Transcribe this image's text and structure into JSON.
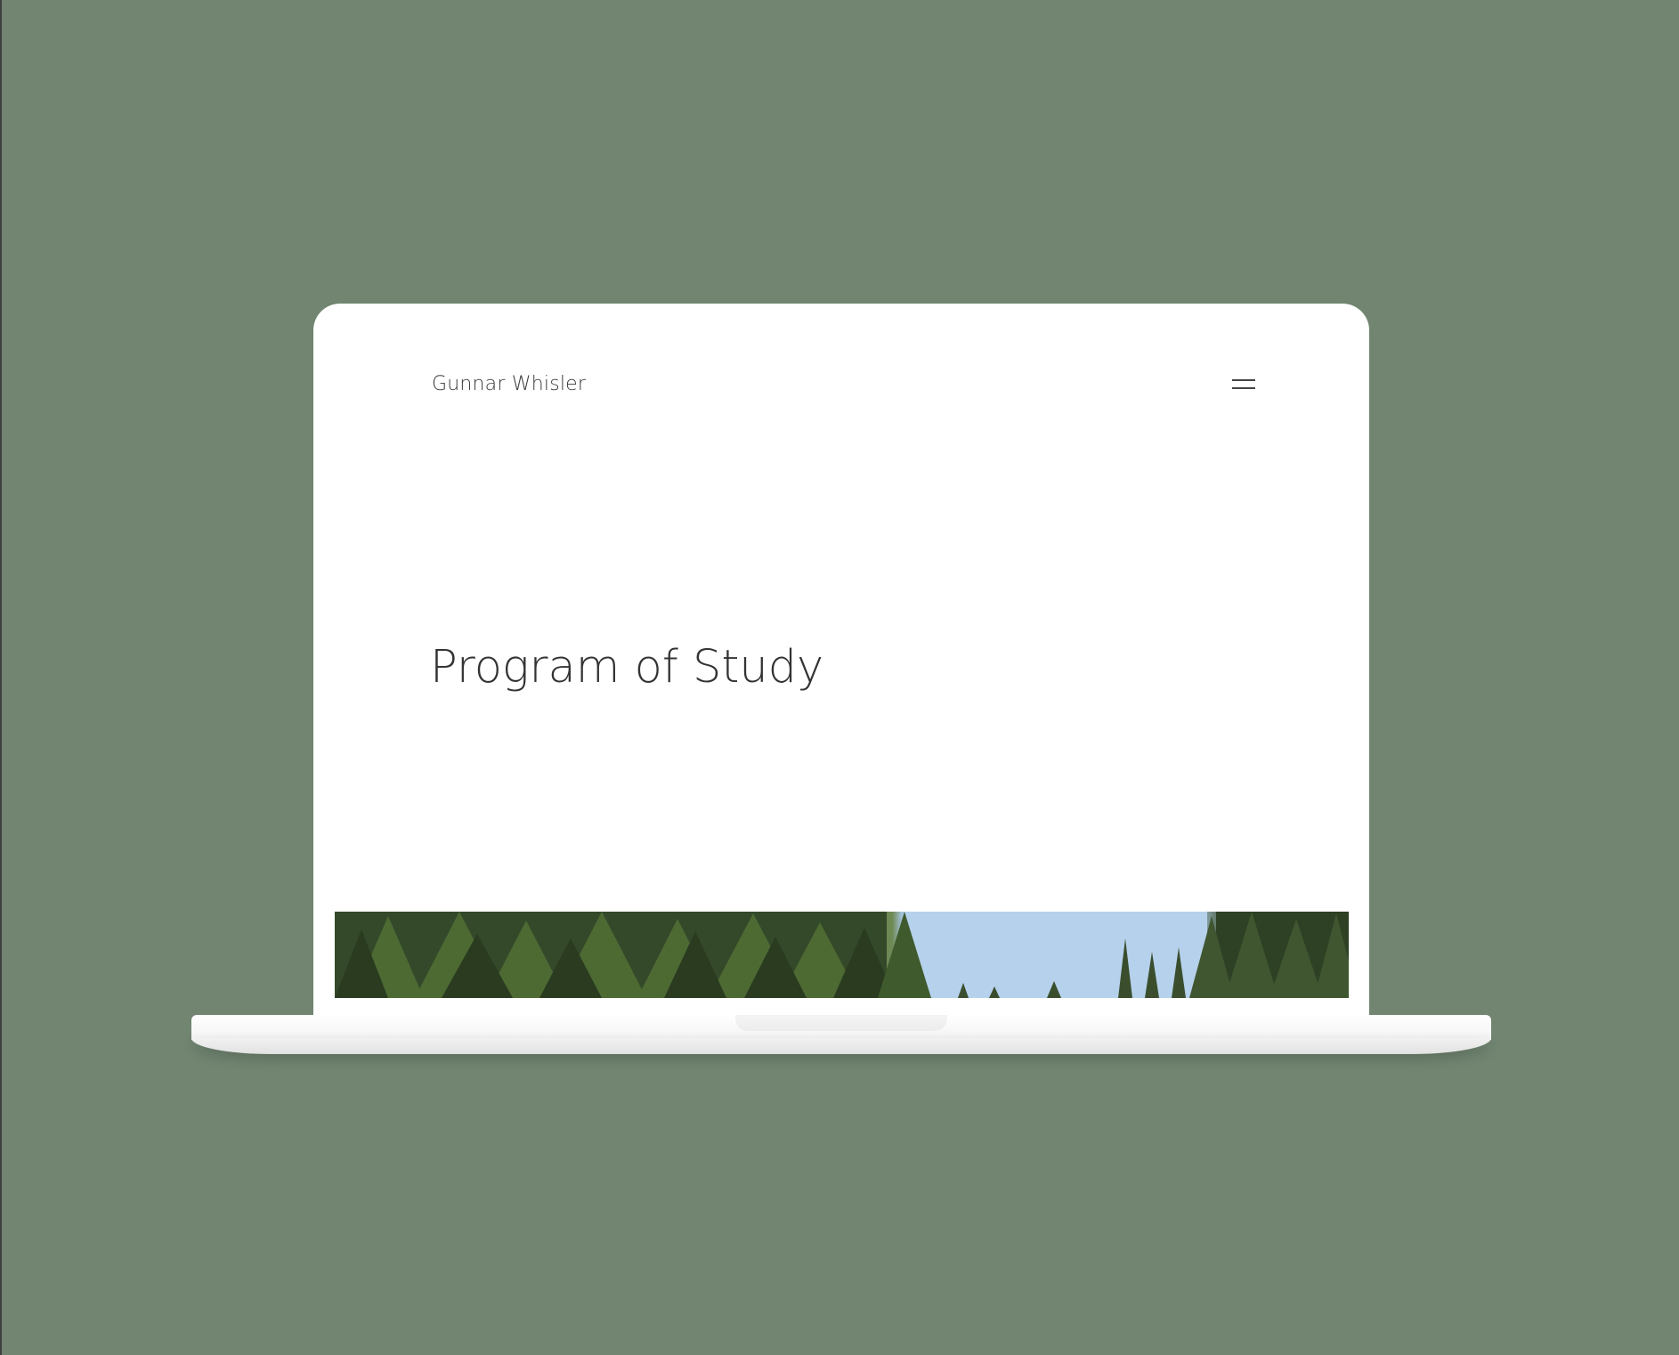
{
  "site": {
    "brand_name": "Gunnar Whisler",
    "menu_icon": "hamburger-icon"
  },
  "hero": {
    "title": "Program of Study"
  },
  "banner": {
    "description_icon": "forest-photo"
  },
  "colors": {
    "background": "#718571",
    "screen": "#ffffff",
    "text": "#333333"
  }
}
